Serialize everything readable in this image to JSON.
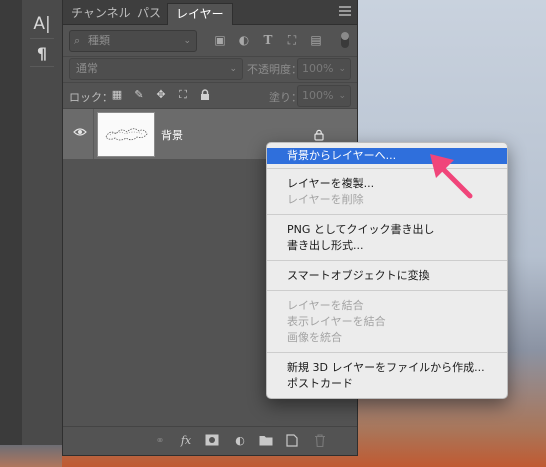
{
  "tool_glyphs": {
    "type_tool": "A|",
    "paragraph": "¶"
  },
  "tabs": [
    {
      "label": "チャンネル",
      "active": false
    },
    {
      "label": "パス",
      "active": false
    },
    {
      "label": "レイヤー",
      "active": true
    }
  ],
  "filter": {
    "kind_label": "種類"
  },
  "blend": {
    "mode": "通常",
    "opacity_label": "不透明度：",
    "opacity_value": "100%"
  },
  "lock": {
    "label": "ロック：",
    "fill_label": "塗り：",
    "fill_value": "100%"
  },
  "layer": {
    "name": "背景"
  },
  "context_menu": {
    "groups": [
      [
        {
          "label": "背景からレイヤーへ...",
          "enabled": true,
          "highlighted": true
        }
      ],
      [
        {
          "label": "レイヤーを複製...",
          "enabled": true
        },
        {
          "label": "レイヤーを削除",
          "enabled": false
        }
      ],
      [
        {
          "label": "PNG としてクイック書き出し",
          "enabled": true
        },
        {
          "label": "書き出し形式...",
          "enabled": true
        }
      ],
      [
        {
          "label": "スマートオブジェクトに変換",
          "enabled": true
        }
      ],
      [
        {
          "label": "レイヤーを結合",
          "enabled": false
        },
        {
          "label": "表示レイヤーを結合",
          "enabled": false
        },
        {
          "label": "画像を統合",
          "enabled": false
        }
      ],
      [
        {
          "label": "新規 3D レイヤーをファイルから作成...",
          "enabled": true
        },
        {
          "label": "ポストカード",
          "enabled": true
        }
      ]
    ]
  },
  "footer_icons": [
    "link-icon",
    "fx-icon",
    "mask-icon",
    "adjustment-icon",
    "folder-icon",
    "new-layer-icon",
    "trash-icon"
  ],
  "footer_labels": {
    "fx": "fx"
  },
  "colors": {
    "highlight": "#2f6fdc",
    "arrow": "#f0457a",
    "panel": "#535353"
  }
}
